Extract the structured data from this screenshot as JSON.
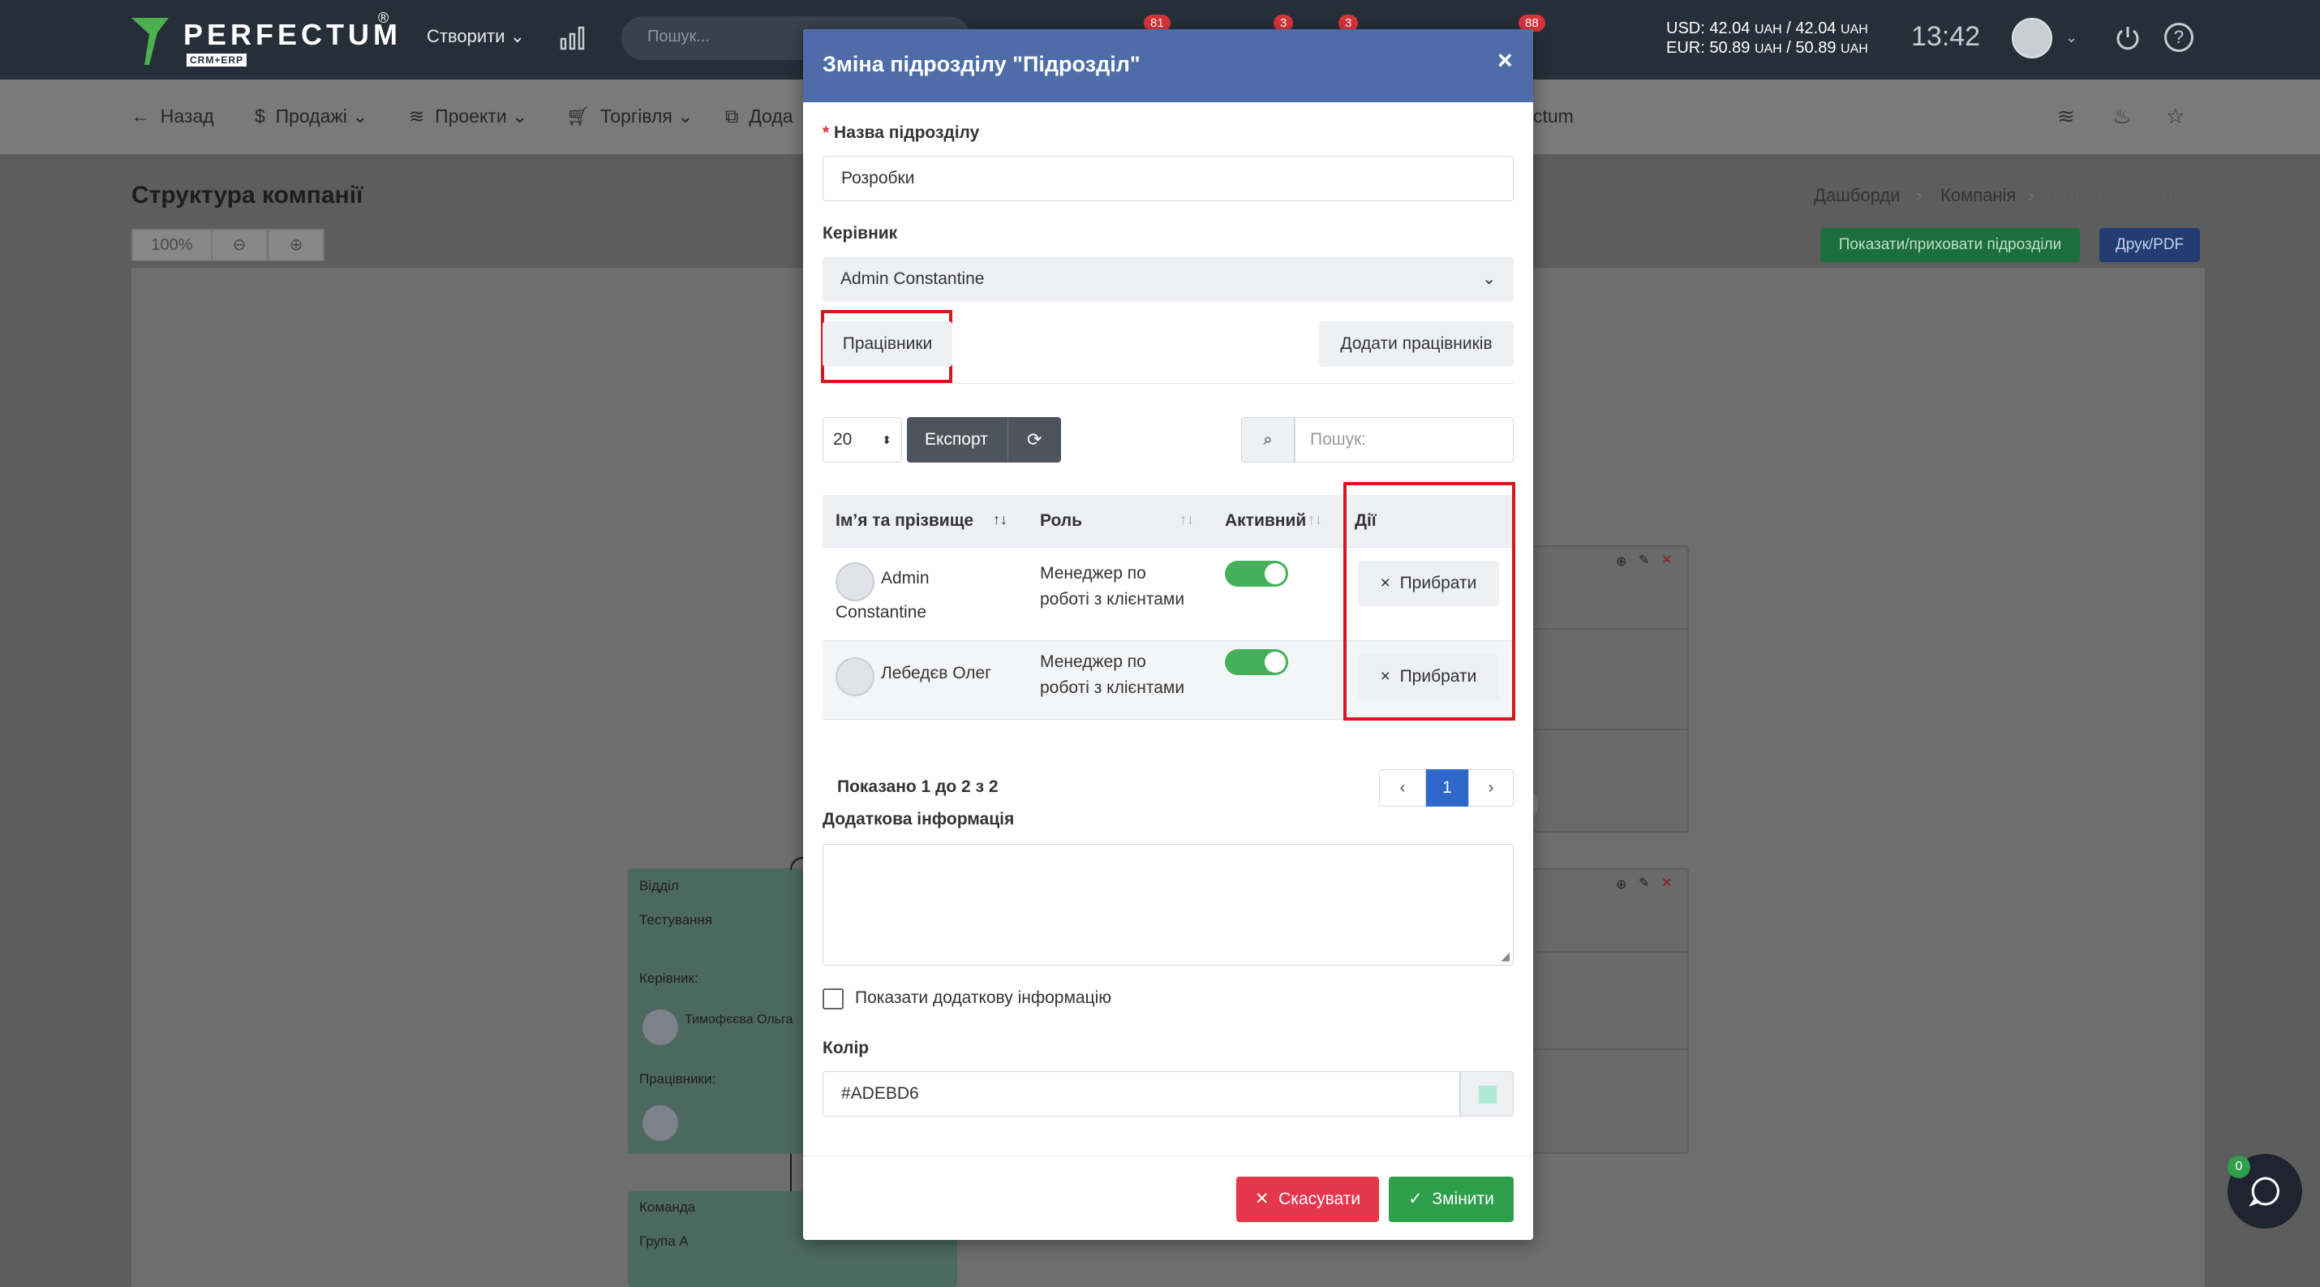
{
  "topbar": {
    "logo": "PERFECTUM",
    "logo_sub": "CRM+ERP",
    "create_label": "Створити",
    "search_placeholder": "Пошук...",
    "badges": [
      "81",
      "3",
      "3",
      "88"
    ],
    "currency_usd": "USD: 42.04",
    "currency_usd_unit1": "UAH",
    "currency_usd_mid": "/ 42.04",
    "currency_usd_unit2": "UAH",
    "currency_eur": "EUR: 50.89",
    "currency_eur_unit1": "UAH",
    "currency_eur_mid": "/ 50.89",
    "currency_eur_unit2": "UAH",
    "clock": "13:42"
  },
  "navbar": {
    "back": "Назад",
    "sales": "Продажі",
    "projects": "Проекти",
    "trade": "Торгівля",
    "add_partial": "Дода",
    "right_partial": "ctum"
  },
  "page": {
    "title": "Структура компанії",
    "breadcrumbs": [
      "Дашборди",
      "Компанія",
      "Структура компанії"
    ],
    "zoom": "100%",
    "show_hide_button": "Показати/приховати підрозділи",
    "print_button": "Друк/PDF"
  },
  "nodes": {
    "dept_label": "Відділ",
    "dept_name": "Тестування",
    "head_label": "Керівник:",
    "head_name": "Тимофєєва Ольга",
    "staff_label": "Працівники:",
    "team_label": "Команда",
    "team_name": "Група А"
  },
  "modal": {
    "title": "Зміна підрозділу \"Підрозділ\"",
    "name_label": "Назва підрозділу",
    "name_value": "Розробки",
    "head_label": "Керівник",
    "head_value": "Admin Constantine",
    "tab_employees": "Працівники",
    "add_employees": "Додати працівників",
    "page_size": "20",
    "export": "Експорт",
    "search_placeholder": "Пошук:",
    "columns": [
      "Ім’я та прізвище",
      "Роль",
      "Активний",
      "Дії"
    ],
    "rows": [
      {
        "name_first": "Admin",
        "name_second": "Constantine",
        "role_1": "Менеджер по",
        "role_2": "роботі з клієнтами",
        "action": "Прибрати"
      },
      {
        "name_first": "Лебедєв Олег",
        "name_second": "",
        "role_1": "Менеджер по",
        "role_2": "роботі з клієнтами",
        "action": "Прибрати"
      }
    ],
    "shown_info": "Показано 1 до 2 з 2",
    "current_page": "1",
    "extra_info_label": "Додаткова інформація",
    "show_extra_label": "Показати додаткову інформацію",
    "color_label": "Колір",
    "color_value": "#ADEBD6",
    "cancel": "Скасувати",
    "save": "Змінити"
  },
  "chat": {
    "count": "0"
  },
  "colors": {
    "header": "#4d6ca8",
    "swatch": "#ADEBD6",
    "accent_green": "#2e9f4b",
    "accent_red": "#e5374b",
    "primary": "#2f68c9"
  }
}
